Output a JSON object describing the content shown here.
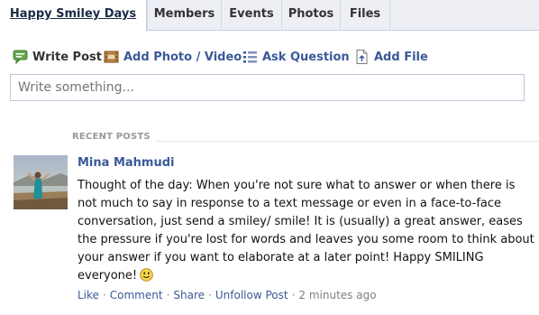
{
  "tabs": [
    {
      "label": "Happy Smiley Days",
      "active": true
    },
    {
      "label": "Members"
    },
    {
      "label": "Events"
    },
    {
      "label": "Photos"
    },
    {
      "label": "Files"
    }
  ],
  "composer": {
    "actions": [
      {
        "label": "Write Post",
        "icon": "write-post-icon",
        "selected": true
      },
      {
        "label": "Add Photo / Video",
        "icon": "photo-video-icon"
      },
      {
        "label": "Ask Question",
        "icon": "question-icon"
      },
      {
        "label": "Add File",
        "icon": "file-icon"
      }
    ],
    "placeholder": "Write something..."
  },
  "recent_posts": {
    "header": "RECENT POSTS",
    "post": {
      "author": "Mina Mahmudi",
      "text": "Thought of the day: When you're not sure what to answer or when there is not much to say in response to a text message or even in a face-to-face conversation, just send a smiley/ smile! It is (usually) a great answer, eases the pressure if you're lost for words and leaves you some room to think about your answer if you want to elaborate at a later point! Happy SMILING everyone!",
      "actions": {
        "like": "Like",
        "comment": "Comment",
        "share": "Share",
        "unfollow": "Unfollow Post",
        "separator": "·",
        "timestamp": "2 minutes ago"
      }
    }
  },
  "colors": {
    "link": "#3b5998",
    "tab_bar": "#edeff4",
    "meta_text": "#808080"
  }
}
